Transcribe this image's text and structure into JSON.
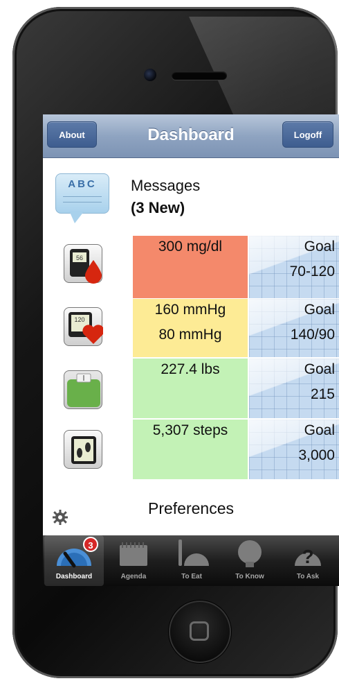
{
  "nav": {
    "title": "Dashboard",
    "left_button": "About",
    "right_button": "Logoff"
  },
  "messages": {
    "icon_text": "ABC",
    "title": "Messages",
    "subtitle": "(3 New)"
  },
  "metrics": [
    {
      "icon": "glucose-meter-icon",
      "value_line1": "300 mg/dl",
      "value_line2": "",
      "value_color": "#f4896b",
      "goal_label": "Goal",
      "goal_value": "70-120",
      "icon_text": "56"
    },
    {
      "icon": "blood-pressure-icon",
      "value_line1": "160 mmHg",
      "value_line2": "80 mmHg",
      "value_color": "#fdeb95",
      "goal_label": "Goal",
      "goal_value": "140/90",
      "icon_text": "120"
    },
    {
      "icon": "scale-icon",
      "value_line1": "227.4 lbs",
      "value_line2": "",
      "value_color": "#c3f2b6",
      "goal_label": "Goal",
      "goal_value": "215",
      "icon_text": ""
    },
    {
      "icon": "pedometer-icon",
      "value_line1": "5,307 steps",
      "value_line2": "",
      "value_color": "#c3f2b6",
      "goal_label": "Goal",
      "goal_value": "3,000",
      "icon_text": ""
    }
  ],
  "preferences": {
    "label": "Preferences"
  },
  "tabs": [
    {
      "label": "Dashboard",
      "icon": "dashboard-gauge-icon",
      "active": true,
      "badge": "3"
    },
    {
      "label": "Agenda",
      "icon": "calendar-icon",
      "active": false
    },
    {
      "label": "To Eat",
      "icon": "fork-plate-icon",
      "active": false
    },
    {
      "label": "To Know",
      "icon": "lightbulb-icon",
      "active": false
    },
    {
      "label": "To Ask",
      "icon": "question-icon",
      "active": false
    }
  ]
}
